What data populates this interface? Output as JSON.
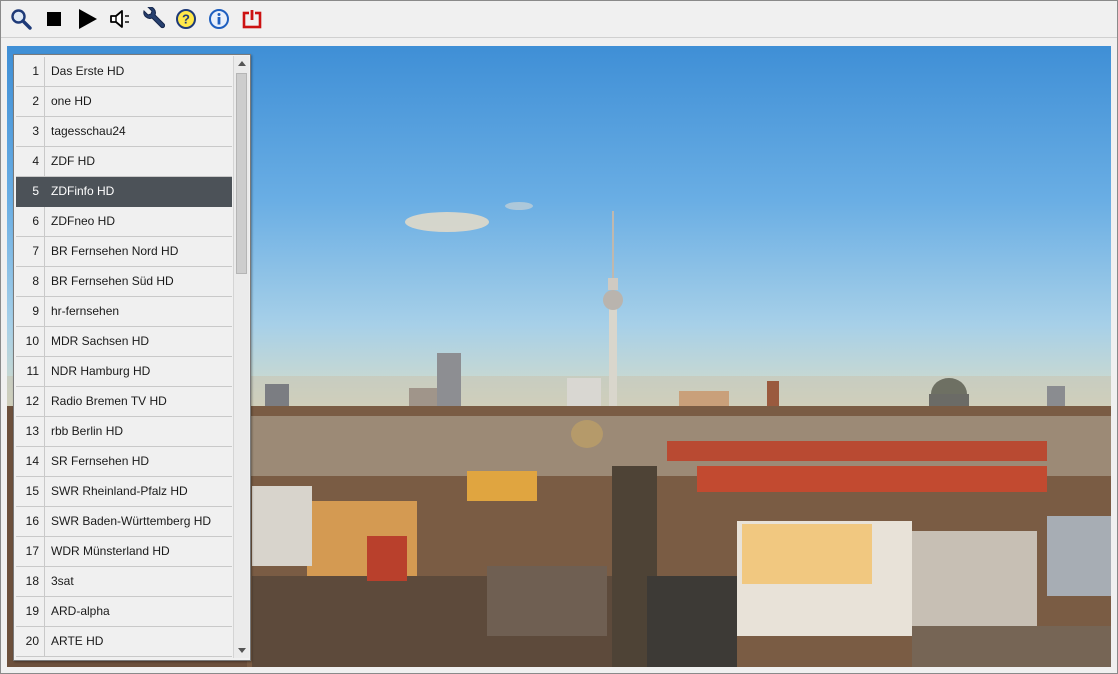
{
  "toolbar": {
    "buttons": [
      {
        "icon": "search-icon"
      },
      {
        "icon": "stop-icon"
      },
      {
        "icon": "play-icon"
      },
      {
        "icon": "speaker-icon"
      },
      {
        "icon": "wrench-icon"
      },
      {
        "icon": "help-icon"
      },
      {
        "icon": "info-icon"
      },
      {
        "icon": "power-icon"
      }
    ]
  },
  "video": {
    "content": "live-tv-frame"
  },
  "channels": [
    {
      "num": "1",
      "name": "Das Erste HD"
    },
    {
      "num": "2",
      "name": "one HD"
    },
    {
      "num": "3",
      "name": "tagesschau24"
    },
    {
      "num": "4",
      "name": "ZDF HD"
    },
    {
      "num": "5",
      "name": "ZDFinfo HD"
    },
    {
      "num": "6",
      "name": "ZDFneo HD"
    },
    {
      "num": "7",
      "name": "BR Fernsehen Nord HD"
    },
    {
      "num": "8",
      "name": "BR Fernsehen Süd HD"
    },
    {
      "num": "9",
      "name": "hr-fernsehen"
    },
    {
      "num": "10",
      "name": "MDR Sachsen HD"
    },
    {
      "num": "11",
      "name": "NDR Hamburg HD"
    },
    {
      "num": "12",
      "name": "Radio Bremen TV HD"
    },
    {
      "num": "13",
      "name": "rbb Berlin HD"
    },
    {
      "num": "14",
      "name": "SR Fernsehen HD"
    },
    {
      "num": "15",
      "name": "SWR Rheinland-Pfalz HD"
    },
    {
      "num": "16",
      "name": "SWR Baden-Württemberg HD"
    },
    {
      "num": "17",
      "name": "WDR Münsterland HD"
    },
    {
      "num": "18",
      "name": "3sat"
    },
    {
      "num": "19",
      "name": "ARD-alpha"
    },
    {
      "num": "20",
      "name": "ARTE HD"
    }
  ],
  "selected_channel": "5",
  "colors": {
    "selection_bg": "#4c5258",
    "power_red": "#cc1111",
    "info_blue": "#1f5fbf"
  }
}
